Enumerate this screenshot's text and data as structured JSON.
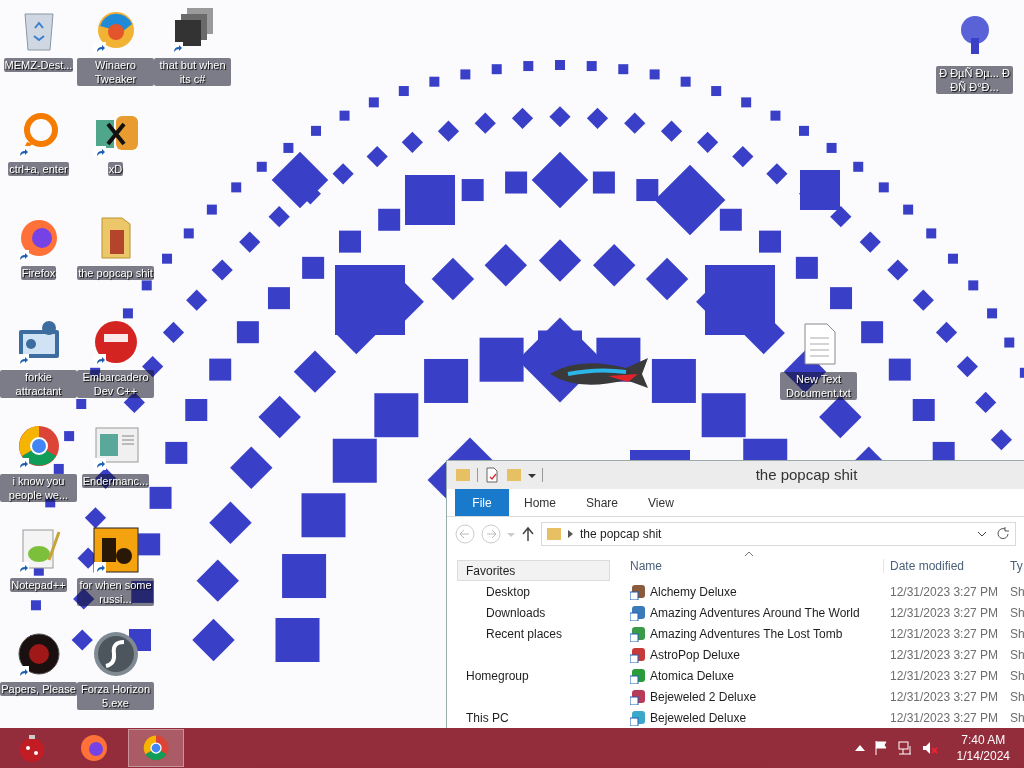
{
  "desktop": {
    "icons": [
      {
        "label": "MEMZ-Dest...",
        "shortcut": false
      },
      {
        "label": "ctrl+a, enter",
        "shortcut": true
      },
      {
        "label": "Firefox",
        "shortcut": true
      },
      {
        "label": "forkie attractant",
        "shortcut": true
      },
      {
        "label": "i know you people we...",
        "shortcut": true
      },
      {
        "label": "Notepad++",
        "shortcut": true
      },
      {
        "label": "Papers, Please",
        "shortcut": true
      },
      {
        "label": "Winaero Tweaker",
        "shortcut": true
      },
      {
        "label": "xD",
        "shortcut": true
      },
      {
        "label": "the popcap shit",
        "shortcut": false
      },
      {
        "label": "Embarcadero Dev C++",
        "shortcut": true
      },
      {
        "label": "Endermanc...",
        "shortcut": true
      },
      {
        "label": "for when some russi...",
        "shortcut": true
      },
      {
        "label": "Forza Horizon 5.exe",
        "shortcut": false
      },
      {
        "label": "that but when its c#",
        "shortcut": true
      }
    ],
    "corner_icon": {
      "label": "Ð ÐµÑ Ðµ... Ð ÐÑ Ð°Ð...",
      "shortcut": false
    },
    "text_file_icon": {
      "label": "New Text Document.txt",
      "shortcut": false
    }
  },
  "explorer": {
    "title": "the popcap shit",
    "tabs": [
      {
        "label": "File",
        "selected": true
      },
      {
        "label": "Home",
        "selected": false
      },
      {
        "label": "Share",
        "selected": false
      },
      {
        "label": "View",
        "selected": false
      }
    ],
    "address": "the popcap shit",
    "navigation": [
      {
        "label": "Favorites",
        "selected": true,
        "children": [
          {
            "label": "Desktop",
            "selected": false
          },
          {
            "label": "Downloads",
            "selected": false
          },
          {
            "label": "Recent places",
            "selected": false
          }
        ]
      },
      {
        "label": "Homegroup",
        "selected": false
      },
      {
        "label": "This PC",
        "selected": false
      }
    ],
    "columns": [
      "Name",
      "Date modified",
      "Ty"
    ],
    "rows": [
      {
        "name": "Alchemy Deluxe",
        "date": "12/31/2023 3:27 PM",
        "column_3": "Sh"
      },
      {
        "name": "Amazing Adventures Around The World",
        "date": "12/31/2023 3:27 PM",
        "column_3": "Sh"
      },
      {
        "name": "Amazing Adventures The Lost Tomb",
        "date": "12/31/2023 3:27 PM",
        "column_3": "Sh"
      },
      {
        "name": "AstroPop Deluxe",
        "date": "12/31/2023 3:27 PM",
        "column_3": "Sh"
      },
      {
        "name": "Atomica Deluxe",
        "date": "12/31/2023 3:27 PM",
        "column_3": "Sh"
      },
      {
        "name": "Bejeweled 2 Deluxe",
        "date": "12/31/2023 3:27 PM",
        "column_3": "Sh"
      },
      {
        "name": "Bejeweled Deluxe",
        "date": "12/31/2023 3:27 PM",
        "column_3": "Sh"
      }
    ]
  },
  "taskbar": {
    "apps": [
      {
        "selected": false
      },
      {
        "selected": false
      },
      {
        "selected": true
      }
    ],
    "time": "7:40 AM",
    "date": "1/14/2024",
    "volume_muted": true
  }
}
